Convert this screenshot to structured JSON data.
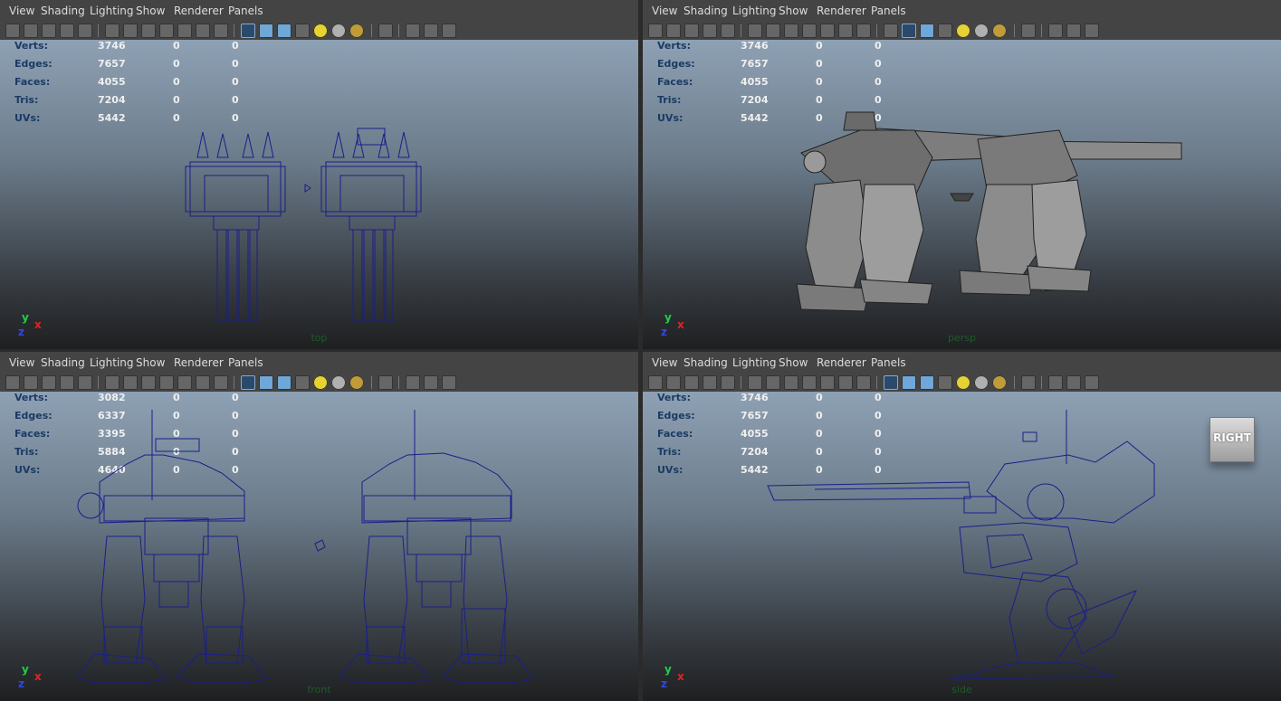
{
  "menu": [
    "View",
    "Shading",
    "Lighting",
    "Show",
    "Renderer",
    "Panels"
  ],
  "hud_labels": [
    "Verts:",
    "Edges:",
    "Faces:",
    "Tris:",
    "UVs:"
  ],
  "colors": {
    "hud_label": "#1b3a63",
    "wire": "#1a1f8a",
    "axis_x": "#e02424",
    "axis_y": "#1fcf4a",
    "axis_z": "#3048e0",
    "camera_label": "#1f5b2a"
  },
  "toolbar_icons": [
    "camera-icon",
    "camera-attr-icon",
    "bookmark-icon",
    "image-plane-icon",
    "2d-pan-zoom-icon",
    "grid-icon",
    "film-gate-icon",
    "resolution-gate-icon",
    "gate-mask-icon",
    "field-chart-icon",
    "safe-action-icon",
    "safe-title-icon",
    "isolate-select-icon",
    "wireframe-icon",
    "smooth-shade-icon",
    "flat-shade-icon",
    "textured-icon",
    "use-all-lights-icon",
    "shadows-icon",
    "ambient-occlusion-icon",
    "xray-icon",
    "xray-joints-icon",
    "backface-icon"
  ],
  "panes": [
    {
      "camera": "top",
      "stats": [
        [
          "3746",
          "0",
          "0"
        ],
        [
          "7657",
          "0",
          "0"
        ],
        [
          "4055",
          "0",
          "0"
        ],
        [
          "7204",
          "0",
          "0"
        ],
        [
          "5442",
          "0",
          "0"
        ]
      ],
      "axis": {
        "y": "y",
        "x": "x",
        "z": "z"
      }
    },
    {
      "camera": "persp",
      "stats": [
        [
          "3746",
          "0",
          "0"
        ],
        [
          "7657",
          "0",
          "0"
        ],
        [
          "4055",
          "0",
          "0"
        ],
        [
          "7204",
          "0",
          "0"
        ],
        [
          "5442",
          "0",
          "0"
        ]
      ],
      "axis": {
        "y": "y",
        "x": "x",
        "z": "z"
      }
    },
    {
      "camera": "front",
      "stats": [
        [
          "3082",
          "0",
          "0"
        ],
        [
          "6337",
          "0",
          "0"
        ],
        [
          "3395",
          "0",
          "0"
        ],
        [
          "5884",
          "0",
          "0"
        ],
        [
          "4640",
          "0",
          "0"
        ]
      ],
      "axis": {
        "y": "y",
        "x": "x",
        "z": "z"
      }
    },
    {
      "camera": "side",
      "stats": [
        [
          "3746",
          "0",
          "0"
        ],
        [
          "7657",
          "0",
          "0"
        ],
        [
          "4055",
          "0",
          "0"
        ],
        [
          "7204",
          "0",
          "0"
        ],
        [
          "5442",
          "0",
          "0"
        ]
      ],
      "axis": {
        "y": "y",
        "x": "x",
        "z": "z"
      },
      "viewcube": "RIGHT"
    }
  ]
}
